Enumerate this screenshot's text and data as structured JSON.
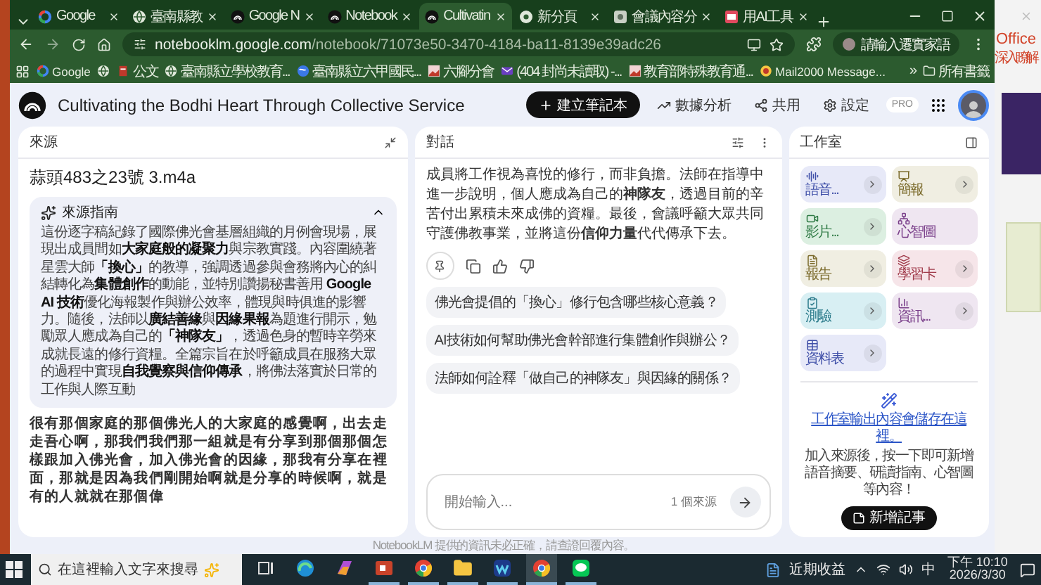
{
  "browser": {
    "tabs": [
      {
        "title": "Google",
        "kind": "google",
        "selected": false
      },
      {
        "title": "臺南縣教",
        "kind": "globe",
        "selected": false
      },
      {
        "title": "Google N",
        "kind": "notebook",
        "selected": false
      },
      {
        "title": "Notebook",
        "kind": "notebook",
        "selected": false
      },
      {
        "title": "Cultivatin",
        "kind": "notebook",
        "selected": true
      },
      {
        "title": "新分頁",
        "kind": "chrome",
        "selected": false
      },
      {
        "title": "會議內容分",
        "kind": "grid",
        "selected": false
      },
      {
        "title": "用AI工具",
        "kind": "slides",
        "selected": false
      }
    ],
    "url_host": "notebooklm.google.com",
    "url_path": "/notebook/71073e50-3470-4184-ba11-8139e39adc26",
    "profile": "請輸入遷實家語",
    "bookmarks": [
      {
        "label": "Google",
        "kind": "google"
      },
      {
        "kind": "globe"
      },
      {
        "label": "公文",
        "kind": "doc"
      },
      {
        "label": "臺南縣立學校教育...",
        "kind": "globe"
      },
      {
        "label": "臺南縣立六甲國民...",
        "kind": "blueglobe"
      },
      {
        "label": "六腳分會",
        "kind": "photo"
      },
      {
        "label": "(404 封尚未讀取) -...",
        "kind": "mail"
      },
      {
        "label": "教育部特殊教育通...",
        "kind": "photo"
      },
      {
        "label": "Mail2000 Message...",
        "kind": "circle"
      }
    ],
    "overflow": "»",
    "all_bookmarks": "所有書籤"
  },
  "app": {
    "title": "Cultivating the Bodhi Heart Through Collective Service",
    "create": "建立筆記本",
    "actions": [
      {
        "label": "數據分析",
        "kind": "analytics"
      },
      {
        "label": "共用",
        "kind": "share"
      },
      {
        "label": "設定",
        "kind": "settings"
      }
    ],
    "badge": "PRO"
  },
  "sources": {
    "title": "來源",
    "file": "蒜頭483之23號 3.m4a",
    "guide": {
      "title": "來源指南",
      "expanded": true,
      "text": "這份逐字稿紀錄了國際佛光會基層組織的月例會現場，展現出成員間如**大家庭般的凝聚力**與宗教實踐。內容圍繞著星雲大師**「換心」**的教導，強調透過參與會務將內心的糾結轉化為**集體創作**的動能，並特別讚揚秘書善用 **Google AI 技術**優化海報製作與辦公效率，體現與時俱進的影響力。隨後，法師以**廣結善緣**與**因緣果報**為題進行開示，勉勵眾人應成為自己的**「神隊友」**，透過色身的暫時辛勞來成就長遠的修行資糧。全篇宗旨在於呼籲成員在服務大眾的過程中實現**自我覺察與信仰傳承**，將佛法落實於日常的工作與人際互動"
    },
    "transcript": "很有那個家庭的那個佛光人的大家庭的感覺啊，出去走走吾心啊，那我們我們那一組就是有分享到那個那個怎樣跟加入佛光會，加入佛光會的因緣，那我有分享在裡面，那就是因為我們剛開始啊就是分享的時候啊，就是有的人就就在那個偉"
  },
  "chat": {
    "title": "對話",
    "answer": "成員將工作視為喜悅的修行，而非負擔。法師在指導中進一步說明，個人應成為自己的**神隊友**，透過目前的辛苦付出累積未來成佛的資糧。最後，會議呼籲大眾共同守護佛教事業，並將這份**信仰力量**代代傳承下去。",
    "suggestions": [
      "佛光會提倡的「換心」修行包含哪些核心意義？",
      "AI技術如何幫助佛光會幹部進行集體創作與辦公？",
      "法師如何詮釋「做自己的神隊友」與因緣的關係？"
    ],
    "input": {
      "placeholder": "開始輸入...",
      "count": "1 個來源"
    }
  },
  "studio": {
    "title": "工作室",
    "tiles": [
      {
        "label": "語音...",
        "kind": "audio",
        "color": "#e7e9f8",
        "arrow": true
      },
      {
        "label": "簡報",
        "kind": "slides",
        "color": "#f0eee2",
        "arrow": true
      },
      {
        "label": "影片...",
        "kind": "video",
        "color": "#dcefe1",
        "arrow": true
      },
      {
        "label": "心智圖",
        "kind": "mindmap",
        "color": "#efe6f1",
        "arrow": false
      },
      {
        "label": "報告",
        "kind": "report",
        "color": "#f0eee2",
        "arrow": true
      },
      {
        "label": "學習卡",
        "kind": "cards",
        "color": "#f6e5e9",
        "arrow": true
      },
      {
        "label": "測驗",
        "kind": "quiz",
        "color": "#d8eff3",
        "arrow": true
      },
      {
        "label": "資訊...",
        "kind": "infographic",
        "color": "#efe6f1",
        "arrow": true
      },
      {
        "label": "資料表",
        "kind": "table",
        "color": "#e7e9f8",
        "arrow": true
      }
    ],
    "hint_link": "工作室輸出內容會儲存在這裡。",
    "hint": "加入來源後，按一下即可新增語音摘要、研讀指南、心智圖等內容！",
    "note_button": "新增記事"
  },
  "footer": "NotebookLM 提供的資訊未必正確，請查證回覆內容。",
  "side_window": {
    "brand": "Office",
    "link": "深入瞭解"
  },
  "taskbar": {
    "search": "在這裡輸入文字來搜尋",
    "apps": [
      {
        "kind": "taskview",
        "running": false
      },
      {
        "kind": "edge",
        "running": false
      },
      {
        "kind": "copilot",
        "running": false
      },
      {
        "kind": "ppt",
        "running": true
      },
      {
        "kind": "chrome",
        "running": true
      },
      {
        "kind": "folder",
        "running": true
      },
      {
        "kind": "webex",
        "running": true
      },
      {
        "kind": "chrome",
        "running": true,
        "selected": true
      },
      {
        "kind": "line",
        "running": true
      }
    ],
    "news": "近期收益",
    "ime": "中",
    "time": "下午 10:10",
    "date": "2026/3/30"
  }
}
